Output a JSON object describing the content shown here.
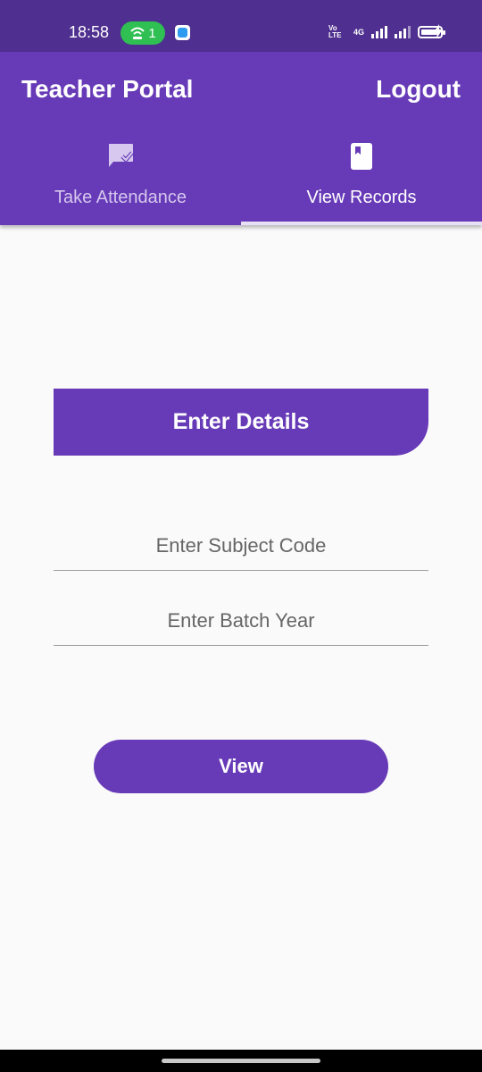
{
  "status_bar": {
    "time": "18:58",
    "hotspot_count": "1",
    "network_type": "4G",
    "volte": "VoLTE"
  },
  "app_bar": {
    "title": "Teacher Portal",
    "logout_label": "Logout",
    "color": "#673ab7"
  },
  "tabs": [
    {
      "label": "Take Attendance",
      "icon": "rate-review-check-icon",
      "selected": false
    },
    {
      "label": "View Records",
      "icon": "book-icon",
      "selected": true
    }
  ],
  "form": {
    "header": "Enter Details",
    "subject_placeholder": "Enter Subject Code",
    "subject_value": "",
    "batch_placeholder": "Enter Batch Year",
    "batch_value": "",
    "submit_label": "View"
  }
}
